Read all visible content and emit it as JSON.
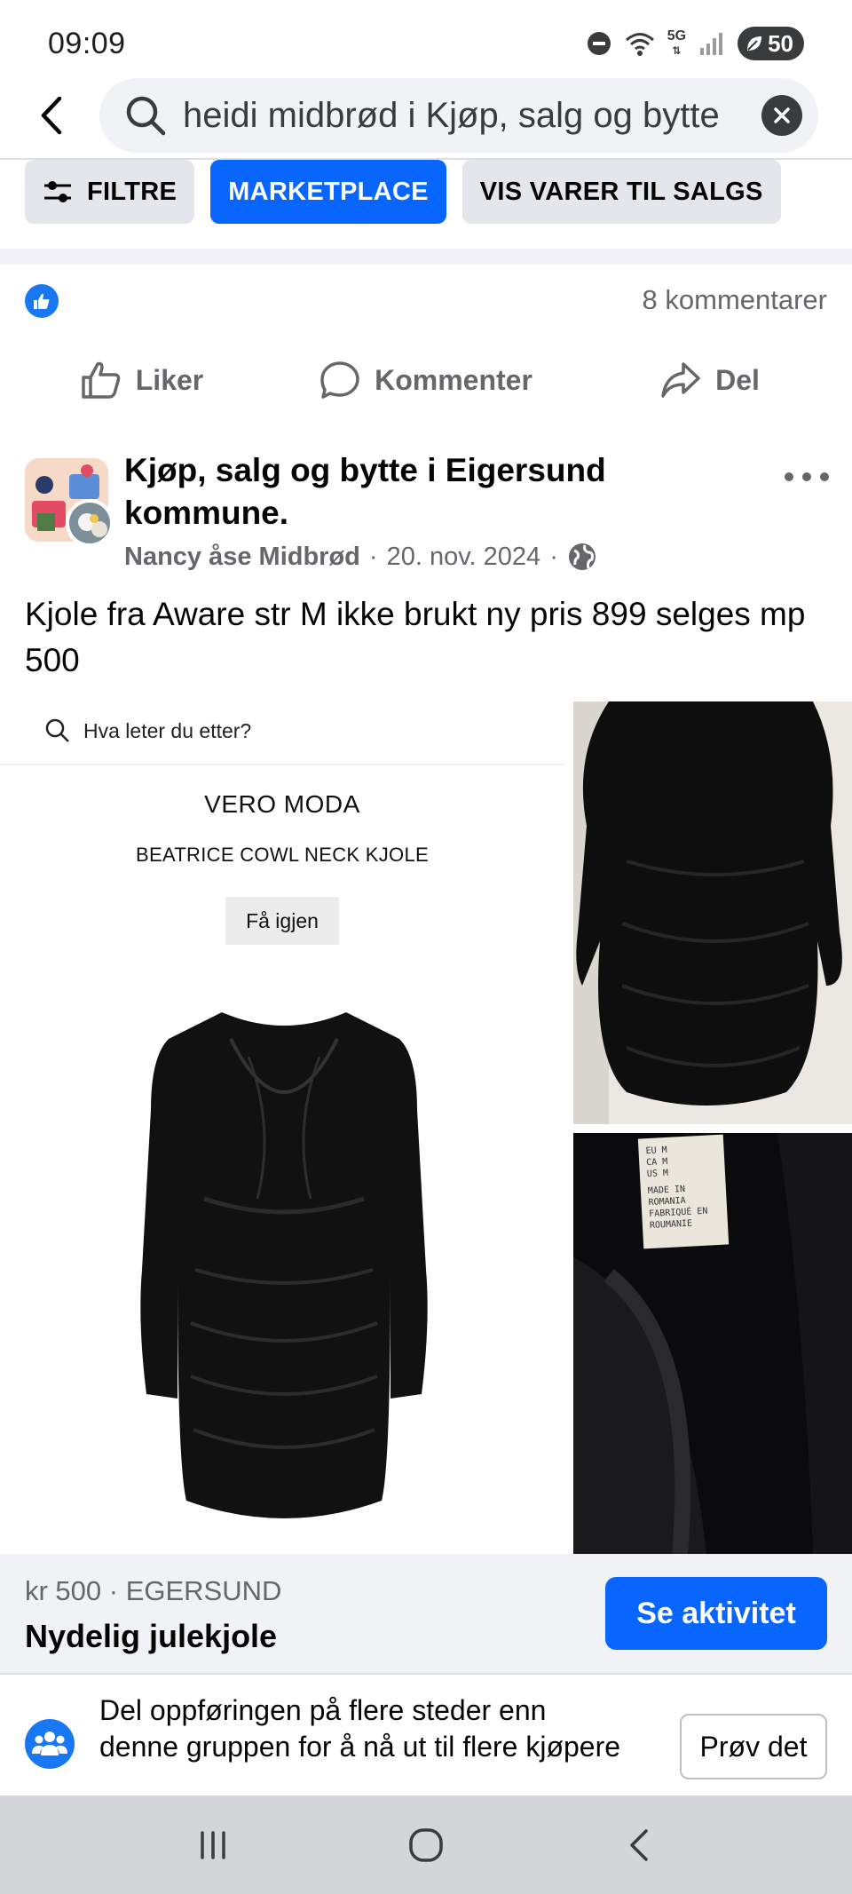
{
  "status_bar": {
    "time": "09:09",
    "network": "5G",
    "battery": "50",
    "icons": [
      "dnd-icon",
      "wifi-icon",
      "5g-icon",
      "signal-icon",
      "battery-icon"
    ]
  },
  "search": {
    "query": "heidi midbrød i Kjøp, salg og bytte"
  },
  "filters": {
    "filter_label": "FILTRE",
    "marketplace_label": "MARKETPLACE",
    "items_for_sale_label": "VIS VARER TIL SALGS"
  },
  "reactions": {
    "comments_count": "8 kommentarer"
  },
  "actions": {
    "like": "Liker",
    "comment": "Kommenter",
    "share": "Del"
  },
  "post": {
    "group_name": "Kjøp, salg og bytte i Eigersund kommune.",
    "author": "Nancy åse Midbrød",
    "date": "20. nov. 2024",
    "separator": "·",
    "text": "Kjole fra Aware str M ikke brukt ny pris 899 selges mp 500"
  },
  "photo_main": {
    "search_placeholder": "Hva leter du etter?",
    "brand": "VERO MODA",
    "product": "BEATRICE COWL NECK KJOLE",
    "button": "Få igjen"
  },
  "photo_label": {
    "lines": [
      "EU    M",
      "CA    M",
      "US    M",
      "MADE IN",
      "ROMANIA",
      "FABRIQUÉ EN",
      "ROUMANIE"
    ]
  },
  "listing": {
    "price_location": "kr 500 · EGERSUND",
    "title": "Nydelig julekjole",
    "cta": "Se aktivitet"
  },
  "promo": {
    "text": "Del oppføringen på flere steder enn denne gruppen for å nå ut til flere kjøpere",
    "button": "Prøv det"
  },
  "colors": {
    "brand_blue": "#0866ff",
    "text_primary": "#050505",
    "text_secondary": "#65676b",
    "surface_gray": "#f0f2f5"
  }
}
